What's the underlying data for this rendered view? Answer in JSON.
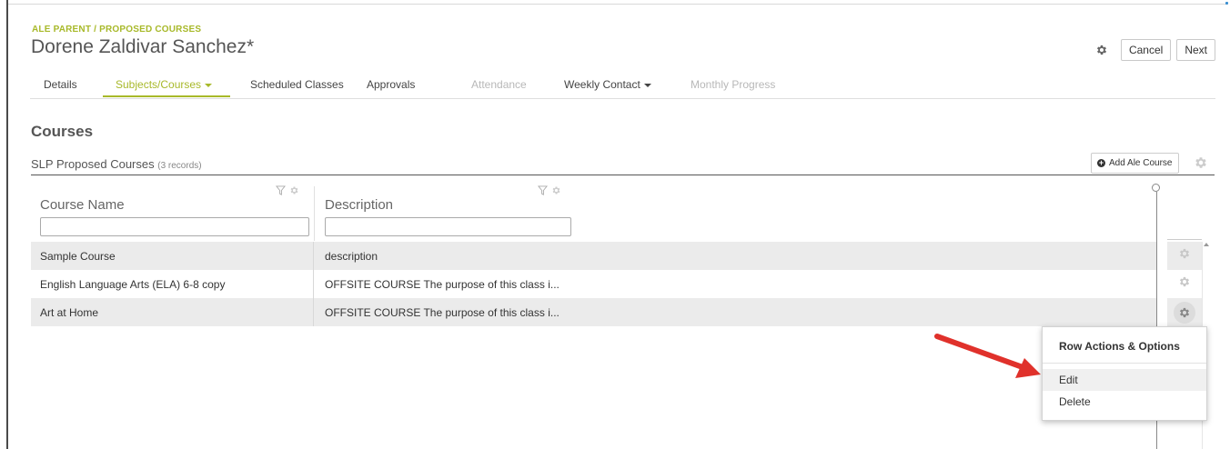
{
  "header": {
    "breadcrumb": "ALE PARENT / PROPOSED COURSES",
    "title": "Dorene Zaldivar Sanchez*",
    "cancel_label": "Cancel",
    "next_label": "Next"
  },
  "tabs": [
    {
      "label": "Details",
      "state": "normal"
    },
    {
      "label": "Subjects/Courses",
      "state": "active"
    },
    {
      "label": "Scheduled Classes",
      "state": "normal"
    },
    {
      "label": "Approvals",
      "state": "normal"
    },
    {
      "label": "Attendance",
      "state": "disabled"
    },
    {
      "label": "Weekly Contact",
      "state": "normal"
    },
    {
      "label": "Monthly Progress",
      "state": "disabled"
    }
  ],
  "section": {
    "title": "Courses"
  },
  "grid": {
    "title": "SLP Proposed Courses",
    "record_count": "(3 records)",
    "add_button_label": "Add Ale Course",
    "columns": [
      "Course Name",
      "Description"
    ],
    "rows": [
      {
        "name": "Sample Course",
        "description": "description"
      },
      {
        "name": "English Language Arts (ELA) 6-8 copy",
        "description": "OFFSITE COURSE The purpose of this class i..."
      },
      {
        "name": "Art at Home",
        "description": "OFFSITE COURSE The purpose of this class i..."
      }
    ]
  },
  "row_menu": {
    "title": "Row Actions & Options",
    "items": [
      "Edit",
      "Delete"
    ]
  },
  "colors": {
    "accent": "#a8b92a",
    "arrow": "#e0312b"
  }
}
